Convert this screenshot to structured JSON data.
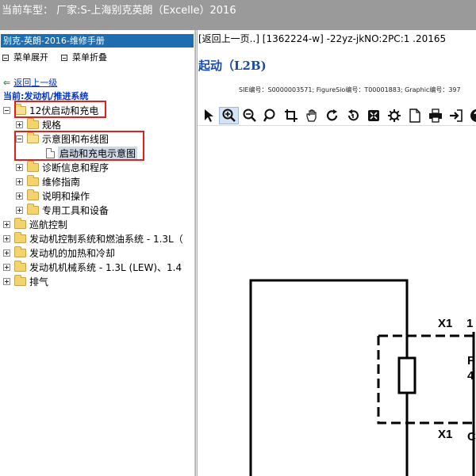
{
  "window": {
    "title": "当前车型： 厂家:S-上海别克英朗（Excelle）2016"
  },
  "sidebar": {
    "manual_title": "别克-英朗-2016-维修手册",
    "expand_label": "菜单展开",
    "collapse_label": "菜单折叠",
    "back_label": "返回上一级",
    "current_label": "当前:发动机/推进系统",
    "tree": [
      {
        "label": "12伏启动和充电",
        "highlighted": true
      },
      {
        "label": "规格"
      },
      {
        "label": "示意图和布线图",
        "highlighted": true
      },
      {
        "label": "启动和充电示意图",
        "selected": true
      },
      {
        "label": "诊断信息和程序"
      },
      {
        "label": "维修指南"
      },
      {
        "label": "说明和操作"
      },
      {
        "label": "专用工具和设备"
      },
      {
        "label": "巡航控制"
      },
      {
        "label": "发动机控制系统和燃油系统 - 1.3L（"
      },
      {
        "label": "发动机的加热和冷却"
      },
      {
        "label": "发动机机械系统 - 1.3L (LEW)、1.4"
      },
      {
        "label": "排气"
      }
    ]
  },
  "content": {
    "breadcrumb": "[返回上一页..] [1362224-w] -22yz-jkNO:2PC:1 .20165",
    "section_title": "起动（L2B)",
    "meta": "SIE编号：S0000003571;  FigureSio编号：T00001883;  Graphic编号：397",
    "toolbar": [
      "select-arrow-icon",
      "zoom-in-icon",
      "zoom-out-icon",
      "magnify-icon",
      "crop-icon",
      "pan-hand-icon",
      "rotate-icon",
      "reset-view-icon",
      "fit-icon",
      "settings-icon",
      "page-icon",
      "print-icon",
      "export-icon",
      "help-icon"
    ],
    "diagram": {
      "labels": [
        "X1",
        "1",
        "F",
        "4",
        "X1",
        "C"
      ]
    }
  },
  "colors": {
    "titlebar": "#9a9a9a",
    "manual_header": "#1e6db0",
    "link": "#0033cc",
    "highlight_box": "#e0201a",
    "section_title": "#1a4aa8"
  }
}
